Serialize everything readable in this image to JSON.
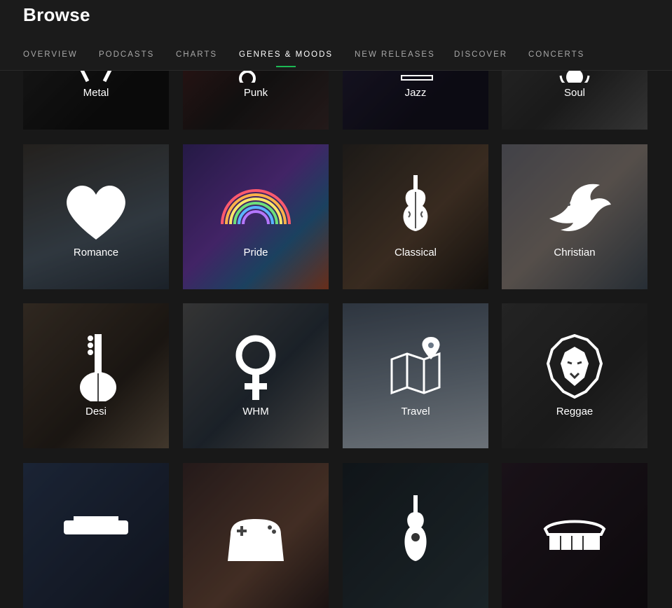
{
  "header": {
    "title": "Browse",
    "tabs": [
      {
        "label": "OVERVIEW",
        "active": false
      },
      {
        "label": "PODCASTS",
        "active": false
      },
      {
        "label": "CHARTS",
        "active": false
      },
      {
        "label": "GENRES & MOODS",
        "active": true
      },
      {
        "label": "NEW RELEASES",
        "active": false
      },
      {
        "label": "DISCOVER",
        "active": false
      },
      {
        "label": "CONCERTS",
        "active": false
      }
    ],
    "accent": "#1db954"
  },
  "genres": [
    {
      "label": "Metal",
      "icon": "metal-icon"
    },
    {
      "label": "Punk",
      "icon": "punk-icon"
    },
    {
      "label": "Jazz",
      "icon": "jazz-icon"
    },
    {
      "label": "Soul",
      "icon": "soul-icon"
    },
    {
      "label": "Romance",
      "icon": "heart-icon"
    },
    {
      "label": "Pride",
      "icon": "rainbow-icon"
    },
    {
      "label": "Classical",
      "icon": "violin-icon"
    },
    {
      "label": "Christian",
      "icon": "dove-icon"
    },
    {
      "label": "Desi",
      "icon": "sitar-icon"
    },
    {
      "label": "WHM",
      "icon": "female-symbol-icon"
    },
    {
      "label": "Travel",
      "icon": "map-pin-icon"
    },
    {
      "label": "Reggae",
      "icon": "lion-icon"
    },
    {
      "label": "",
      "icon": "typewriter-icon"
    },
    {
      "label": "",
      "icon": "gamepad-icon"
    },
    {
      "label": "",
      "icon": "guitar-icon"
    },
    {
      "label": "",
      "icon": "teeth-icon"
    }
  ]
}
